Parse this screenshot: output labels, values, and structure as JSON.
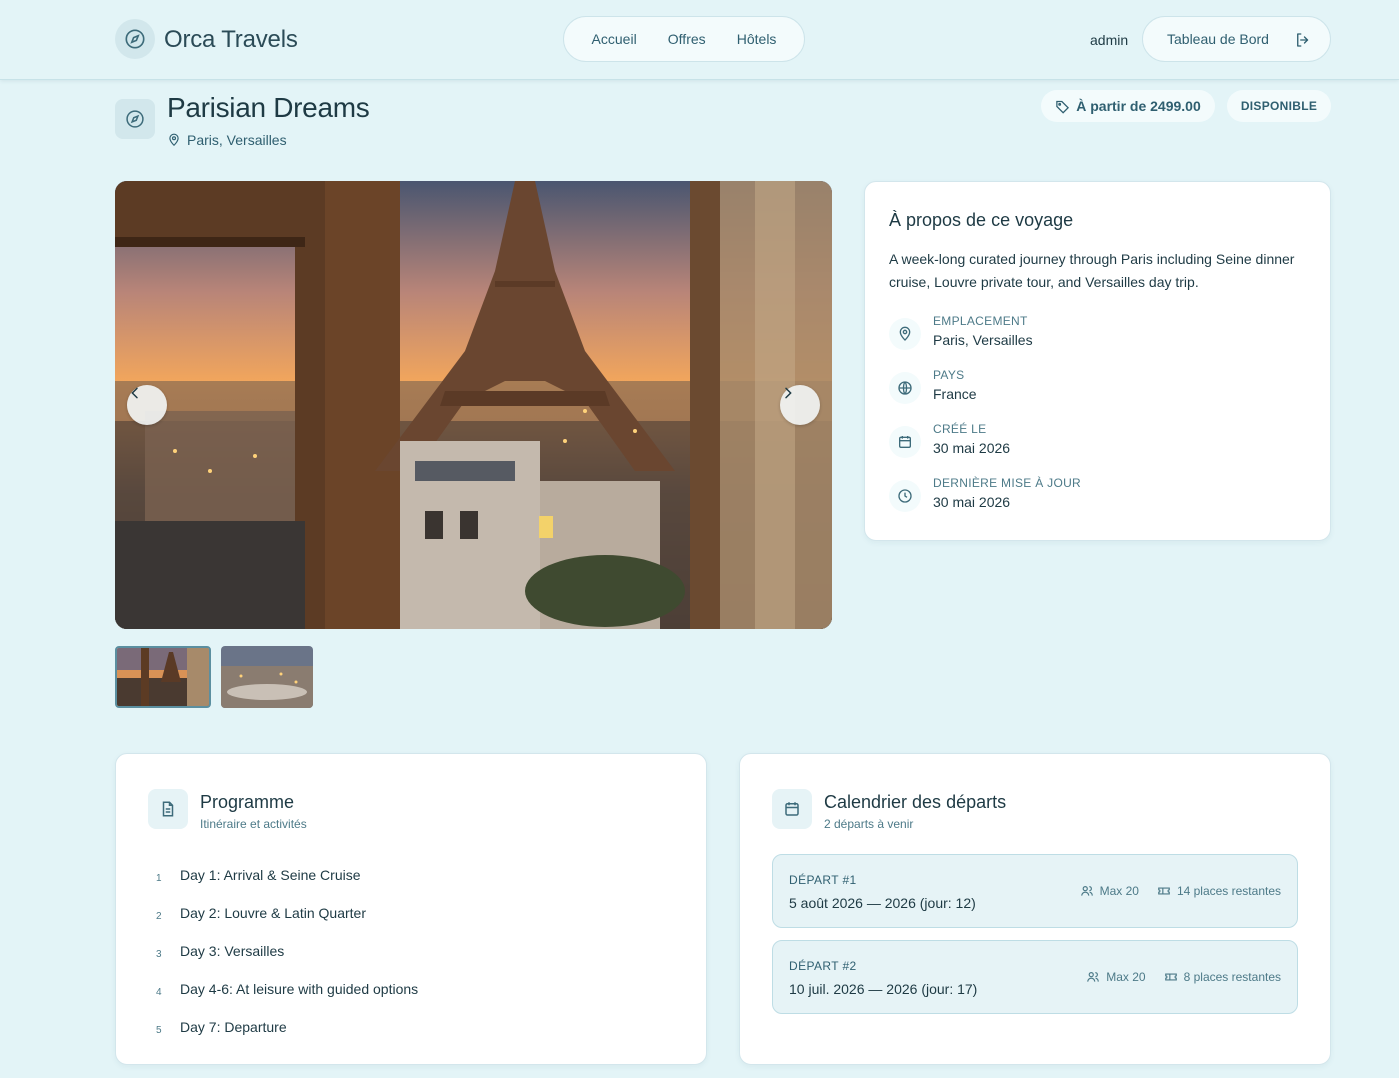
{
  "header": {
    "brand": "Orca Travels",
    "nav": [
      "Accueil",
      "Offres",
      "Hôtels"
    ],
    "user": "admin",
    "dashboard_label": "Tableau de Bord"
  },
  "trip": {
    "title": "Parisian Dreams",
    "location": "Paris, Versailles",
    "price_label": "À partir de 2499.00",
    "status": "DISPONIBLE"
  },
  "about": {
    "title": "À propos de ce voyage",
    "description": "A week-long curated journey through Paris including Seine dinner cruise, Louvre private tour, and Versailles day trip.",
    "rows": [
      {
        "label": "EMPLACEMENT",
        "value": "Paris, Versailles",
        "icon": "map-pin-icon"
      },
      {
        "label": "PAYS",
        "value": "France",
        "icon": "globe-icon"
      },
      {
        "label": "CRÉÉ LE",
        "value": "30 mai 2026",
        "icon": "calendar-icon"
      },
      {
        "label": "DERNIÈRE MISE À JOUR",
        "value": "30 mai 2026",
        "icon": "clock-icon"
      }
    ]
  },
  "programme": {
    "title": "Programme",
    "subtitle": "Itinéraire et activités",
    "items": [
      {
        "num": "1",
        "text": "Day 1: Arrival & Seine Cruise"
      },
      {
        "num": "2",
        "text": "Day 2: Louvre & Latin Quarter"
      },
      {
        "num": "3",
        "text": "Day 3: Versailles"
      },
      {
        "num": "4",
        "text": "Day 4-6: At leisure with guided options"
      },
      {
        "num": "5",
        "text": "Day 7: Departure"
      }
    ]
  },
  "calendar": {
    "title": "Calendrier des départs",
    "subtitle": "2 départs à venir",
    "departures": [
      {
        "label": "DÉPART #1",
        "dates": "5 août 2026 — 2026 (jour: 12)",
        "max": "Max 20",
        "places": "14 places restantes"
      },
      {
        "label": "DÉPART #2",
        "dates": "10 juil. 2026 — 2026 (jour: 17)",
        "max": "Max 20",
        "places": "8 places restantes"
      }
    ]
  }
}
